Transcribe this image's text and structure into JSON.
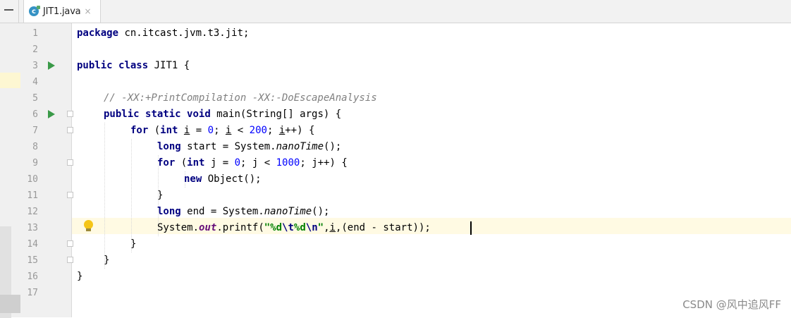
{
  "tab": {
    "title": "JIT1.java",
    "close_glyph": "×",
    "icon": "java-class-icon",
    "icon_letter": "c"
  },
  "line_numbers": [
    "1",
    "2",
    "3",
    "4",
    "5",
    "6",
    "7",
    "8",
    "9",
    "10",
    "11",
    "12",
    "13",
    "14",
    "15",
    "16",
    "17"
  ],
  "code": {
    "l1": {
      "kw1": "package",
      "t1": " cn.itcast.jvm.t3.jit;"
    },
    "l3": {
      "kw1": "public",
      "kw2": "class",
      "t1": " JIT1 {"
    },
    "l5": {
      "comment": "// -XX:+PrintCompilation -XX:-DoEscapeAnalysis"
    },
    "l6": {
      "kw1": "public",
      "kw2": "static",
      "kw3": "void",
      "t1": " main(String[] args) {"
    },
    "l7": {
      "kw1": "for",
      "t1": " (",
      "kw2": "int",
      "v1": "i",
      "t2": " = ",
      "n1": "0",
      "t3": "; ",
      "v2": "i",
      "t4": " < ",
      "n2": "200",
      "t5": "; ",
      "v3": "i",
      "t6": "++) {"
    },
    "l8": {
      "kw1": "long",
      "t1": " start = System.",
      "it1": "nanoTime",
      "t2": "();"
    },
    "l9": {
      "kw1": "for",
      "t1": " (",
      "kw2": "int",
      "t2": " j = ",
      "n1": "0",
      "t3": "; j < ",
      "n2": "1000",
      "t4": "; j++) {"
    },
    "l10": {
      "kw1": "new",
      "t1": " Object();"
    },
    "l11": {
      "t1": "}"
    },
    "l12": {
      "kw1": "long",
      "t1": " end = System.",
      "it1": "nanoTime",
      "t2": "();"
    },
    "l13": {
      "t1": "System.",
      "fld": "out",
      "t2": ".printf(",
      "s1": "\"%d",
      "e1": "\\t",
      "s2": "%d",
      "e2": "\\n",
      "s3": "\"",
      "t3": ",",
      "v1": "i",
      "t4": ",(end - start));"
    },
    "l14": {
      "t1": "}"
    },
    "l15": {
      "t1": "}"
    },
    "l16": {
      "t1": "}"
    }
  },
  "watermark": "CSDN @风中追风FF",
  "colors": {
    "keyword": "#000080",
    "number": "#0000ff",
    "string": "#008000",
    "comment": "#808080",
    "field": "#660e7a",
    "run_marker": "#3a9a48",
    "current_line": "#fffae3"
  }
}
